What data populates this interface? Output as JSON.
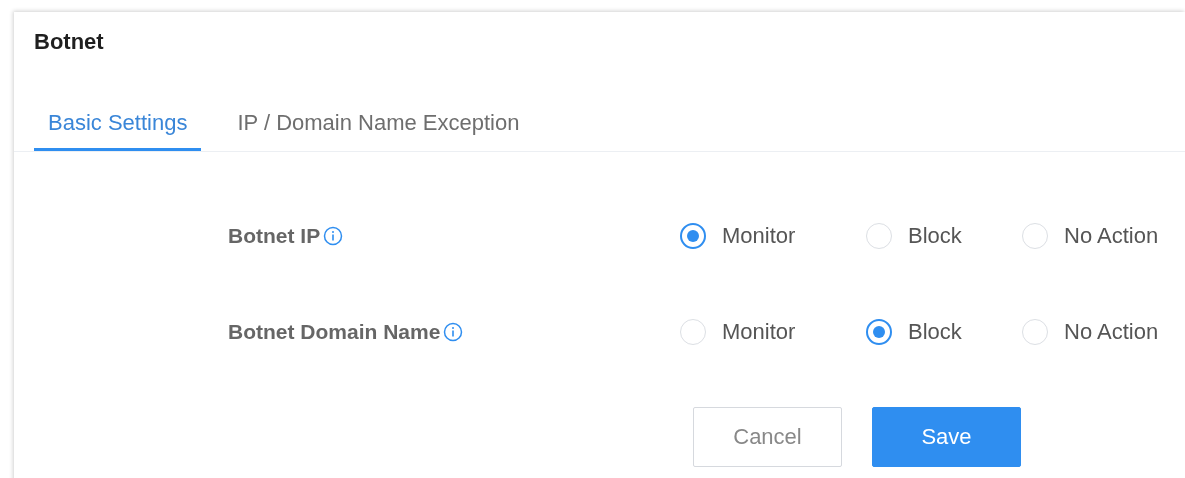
{
  "title": "Botnet",
  "tabs": [
    {
      "label": "Basic Settings",
      "selected": true
    },
    {
      "label": "IP / Domain Name Exception",
      "selected": false
    }
  ],
  "settings": [
    {
      "label": "Botnet IP",
      "info": true,
      "options": [
        {
          "label": "Monitor",
          "selected": true
        },
        {
          "label": "Block",
          "selected": false
        },
        {
          "label": "No Action",
          "selected": false
        }
      ]
    },
    {
      "label": "Botnet Domain Name",
      "info": true,
      "options": [
        {
          "label": "Monitor",
          "selected": false
        },
        {
          "label": "Block",
          "selected": true
        },
        {
          "label": "No Action",
          "selected": false
        }
      ]
    }
  ],
  "buttons": [
    {
      "label": "Cancel",
      "kind": "secondary"
    },
    {
      "label": "Save",
      "kind": "primary"
    }
  ]
}
